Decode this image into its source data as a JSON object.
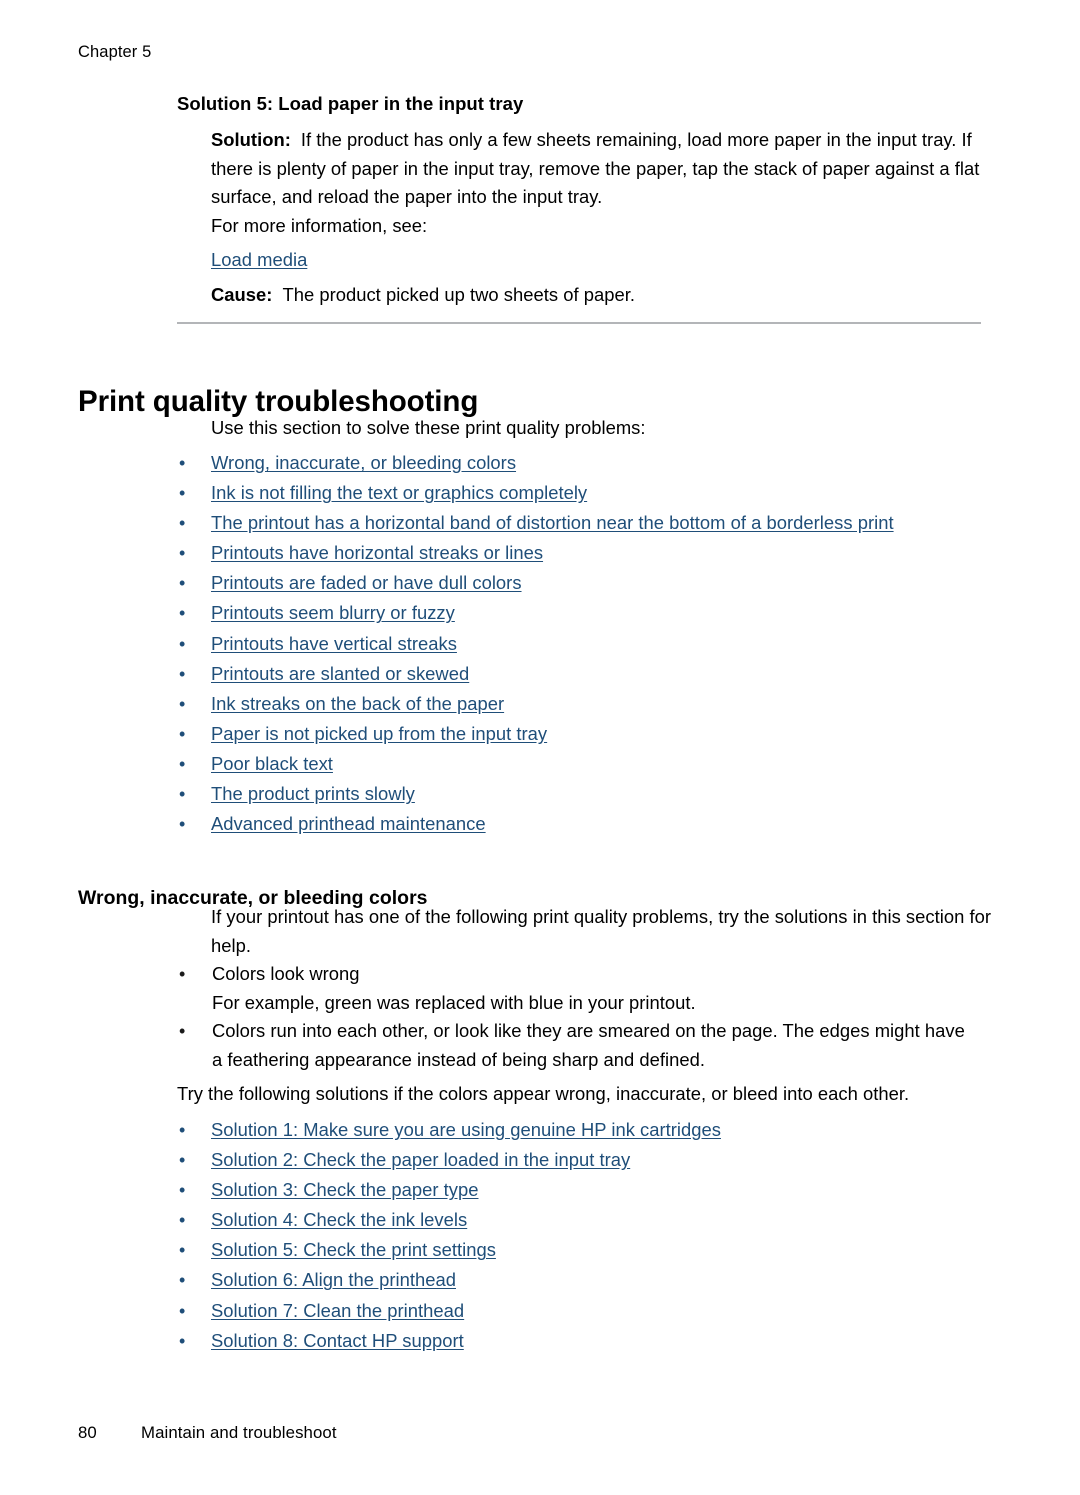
{
  "colors": {
    "link": "#1f4e79",
    "rule": "#b3b5b8",
    "text": "#000000"
  },
  "running_head": "Chapter 5",
  "solution_block": {
    "heading": "Solution 5: Load paper in the input tray",
    "solution_label": "Solution:",
    "solution_text": "If the product has only a few sheets remaining, load more paper in the input tray. If there is plenty of paper in the input tray, remove the paper, tap the stack of paper against a flat surface, and reload the paper into the input tray.",
    "more_info": "For more information, see:",
    "more_info_link": "Load media",
    "cause_label": "Cause:",
    "cause_text": "The product picked up two sheets of paper."
  },
  "section": {
    "title": "Print quality troubleshooting",
    "intro": "Use this section to solve these print quality problems:",
    "links": [
      "Wrong, inaccurate, or bleeding colors",
      "Ink is not filling the text or graphics completely",
      "The printout has a horizontal band of distortion near the bottom of a borderless print",
      "Printouts have horizontal streaks or lines",
      "Printouts are faded or have dull colors",
      "Printouts seem blurry or fuzzy",
      "Printouts have vertical streaks",
      "Printouts are slanted or skewed",
      "Ink streaks on the back of the paper",
      "Paper is not picked up from the input tray",
      "Poor black text",
      "The product prints slowly",
      "Advanced printhead maintenance"
    ]
  },
  "subsection": {
    "title": "Wrong, inaccurate, or bleeding colors",
    "intro": "If your printout has one of the following print quality problems, try the solutions in this section for help.",
    "symptoms": [
      {
        "text": "Colors look wrong",
        "sub": "For example, green was replaced with blue in your printout."
      },
      {
        "text": "Colors run into each other, or look like they are smeared on the page. The edges might have a feathering appearance instead of being sharp and defined.",
        "sub": ""
      }
    ],
    "try_text": "Try the following solutions if the colors appear wrong, inaccurate, or bleed into each other.",
    "solution_links": [
      "Solution 1: Make sure you are using genuine HP ink cartridges",
      "Solution 2: Check the paper loaded in the input tray",
      "Solution 3: Check the paper type",
      "Solution 4: Check the ink levels",
      "Solution 5: Check the print settings",
      "Solution 6: Align the printhead",
      "Solution 7: Clean the printhead",
      "Solution 8: Contact HP support"
    ]
  },
  "footer": {
    "page_number": "80",
    "section_name": "Maintain and troubleshoot"
  },
  "bullet_glyph": "•"
}
